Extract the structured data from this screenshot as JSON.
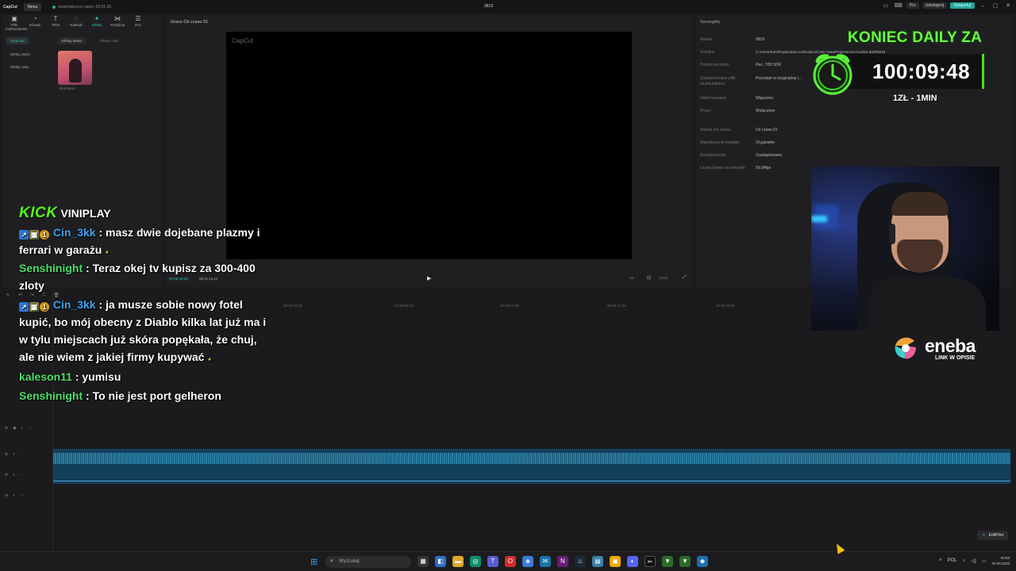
{
  "app": {
    "logo": "CapCut",
    "menu_label": "Menu",
    "autosave": "Automatyczny zapis: 00:51:26",
    "project_title": "0819",
    "pro_label": "Pro",
    "share_label": "Udostępnij",
    "export_label": "Eksportuj"
  },
  "left_panel": {
    "tools": [
      {
        "label": "Pliki multimedialne",
        "icon": "media-icon"
      },
      {
        "label": "Dźwięk",
        "icon": "audio-icon"
      },
      {
        "label": "Tekst",
        "icon": "text-icon"
      },
      {
        "label": "Naklejki",
        "icon": "sticker-icon"
      },
      {
        "label": "Efekty",
        "icon": "effects-icon"
      },
      {
        "label": "Przejścia",
        "icon": "transitions-icon"
      },
      {
        "label": "Poc",
        "icon": "more-icon"
      }
    ],
    "categories": [
      "Ulubione",
      "Efekty wideo",
      "Efekty ciała"
    ],
    "subtabs": [
      "Efekty wideo",
      "Efekty ciała"
    ],
    "thumb_label": "Rozmycie"
  },
  "preview": {
    "title": "Gracz-Oś czasu 01",
    "watermark": "CapCut",
    "time_current": "00:08:40:29",
    "time_total": "00:11:14:12"
  },
  "details": {
    "title": "Szczegóły",
    "rows": [
      {
        "label": "Nazwa:",
        "value": "0819"
      },
      {
        "label": "Ścieżka:",
        "value": "C:/Users/Kamil/AppData/Local/CapCut/User Data/Projects/com.lveditor.draft/0819"
      },
      {
        "label": "Przestrzeń barw:",
        "value": "Rec. 709 SDR"
      },
      {
        "label": "Zaimportowane pliki multimedialne:",
        "value": "Pozostań w oryginalnej l..."
      },
      {
        "label": "Układ warstwy:",
        "value": "Włączono"
      },
      {
        "label": "Proxy:",
        "value": "Wyłączono"
      },
      {
        "label": "Nazwa osi czasu:",
        "value": "Oś czasu 01"
      },
      {
        "label": "Współczynnik kształtu:",
        "value": "Oryginalne"
      },
      {
        "label": "Rozdzielczość:",
        "value": "Zaadaptowano"
      },
      {
        "label": "Liczba klatek na sekundę:",
        "value": "59.94fps"
      }
    ]
  },
  "timeline": {
    "ruler": [
      "00:09:01:36",
      "00:09:05:36",
      "00:09:13:36",
      "00:09:21:36",
      "00:09:23:36"
    ],
    "editpilot": "EditPilot"
  },
  "taskbar": {
    "search_placeholder": "Wyszukaj",
    "language": "POL",
    "time": "00:53",
    "date": "20.08.2026"
  },
  "overlay": {
    "kick_logo": "KICK",
    "channel": "VINIPLAY",
    "messages": [
      {
        "user": "Cin_3kk",
        "user_color": "#3fa6f2",
        "badges": true,
        "text": ": masz dwie dojebane plazmy i",
        "cont": "ferrari w garażu"
      },
      {
        "user": "Senshinight",
        "user_color": "#4ee06a",
        "badges": false,
        "text": ": Teraz okej tv kupisz za 300-400",
        "cont": "zloty"
      },
      {
        "user": "Cin_3kk",
        "user_color": "#3fa6f2",
        "badges": true,
        "text": ": ja musze sobie nowy fotel",
        "cont": "kupić, bo mój obecny z Diablo kilka lat już ma i",
        "cont2": "w tylu miejscach już skóra popękała, że chuj,",
        "cont3": "ale nie wiem z jakiej firmy kupywać"
      },
      {
        "user": "kaleson11",
        "user_color": "#4ee06a",
        "badges": false,
        "text": ": yumisu"
      },
      {
        "user": "Senshinight",
        "user_color": "#4ee06a",
        "badges": false,
        "text": ": To nie jest port gelheron"
      }
    ],
    "timer_title": "KONIEC DAILY ZA",
    "timer_value": "100:09:48",
    "timer_rate": "1ZŁ - 1MIN",
    "sponsor": "eneba",
    "sponsor_sub": "LINK W OPISIE",
    "accent": "#53fc18"
  }
}
